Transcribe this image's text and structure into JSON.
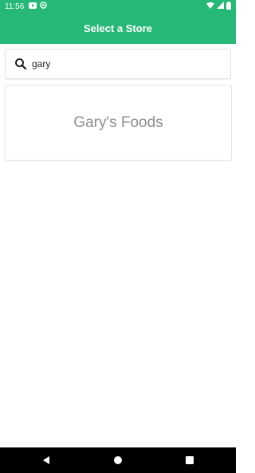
{
  "status_bar": {
    "time": "11:56",
    "left_icons": [
      "youtube-icon",
      "circle-notification-icon"
    ],
    "right_icons": [
      "wifi-icon",
      "signal-icon",
      "battery-icon"
    ]
  },
  "app_bar": {
    "title": "Select a Store"
  },
  "search": {
    "value": "gary",
    "icon": "search-icon"
  },
  "results": [
    {
      "name": "Gary's Foods"
    }
  ],
  "nav_bar": {
    "buttons": [
      "back-icon",
      "home-icon",
      "recents-icon"
    ]
  },
  "colors": {
    "primary": "#25b876",
    "card_text": "#8d8d8d"
  }
}
